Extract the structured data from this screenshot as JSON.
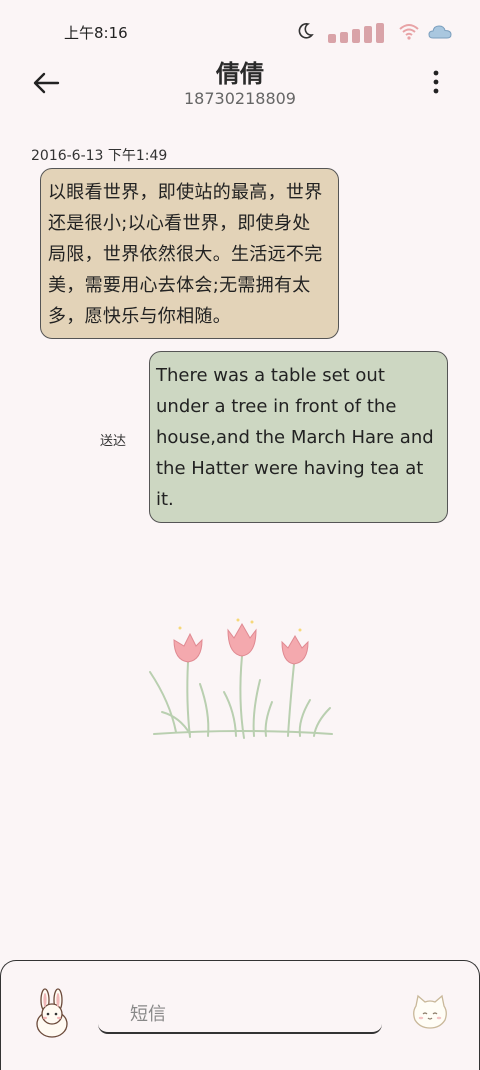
{
  "status": {
    "time": "上午8:16"
  },
  "header": {
    "contact_name": "倩倩",
    "phone_number": "18730218809"
  },
  "messages": [
    {
      "direction": "incoming",
      "timestamp": "2016-6-13 下午1:49",
      "lines": [
        "以眼看世界，即使站的最高，世界",
        "还是很小;以心看世界，即使身处",
        "局限，世界依然很大。生活远不完",
        "美，需要用心去体会;无需拥有太",
        "多，愿快乐与你相随。"
      ]
    },
    {
      "direction": "outgoing",
      "status": "送达",
      "lines": [
        "There was a table set out",
        "under a tree in front of the",
        "house,and the March Hare and",
        "the Hatter were having tea at",
        "it."
      ]
    }
  ],
  "composer": {
    "placeholder": "短信"
  },
  "colors": {
    "background": "#fbf5f6",
    "incoming_bubble": "#e3d3b8",
    "outgoing_bubble": "#cdd7c2",
    "tulip": "#f4a9ae",
    "signal": "#d9a3a8"
  }
}
